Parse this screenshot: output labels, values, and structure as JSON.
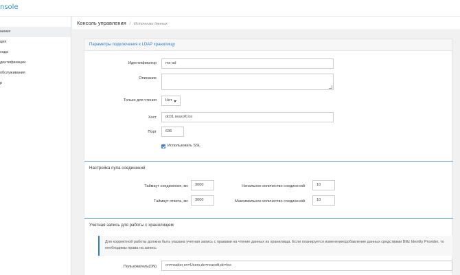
{
  "app": {
    "brand": "nsole"
  },
  "sidebar": {
    "items": [
      {
        "label": "нения",
        "active": true
      },
      {
        "label": "ция",
        "active": false
      },
      {
        "label": "хода",
        "active": false
      },
      {
        "label": "дентификации",
        "active": false
      },
      {
        "label": "обслуживания",
        "active": false
      },
      {
        "label": "р",
        "active": false
      }
    ]
  },
  "header": {
    "title": "Консоль управления",
    "separator": "/",
    "breadcrumb": "Источники данных"
  },
  "card": {
    "title": "Параметры подключения к LDAP хранилищу"
  },
  "form": {
    "identifier": {
      "label": "Идентификатор",
      "value": "ms-ad"
    },
    "description": {
      "label": "Описание",
      "value": ""
    },
    "readonly": {
      "label": "Только для чтения",
      "value": "Нет"
    },
    "host": {
      "label": "Хост",
      "value": "dc01.reaxoft.loc"
    },
    "port": {
      "label": "Порт",
      "value": "636"
    },
    "ssl": {
      "label": "Использовать SSL",
      "checked": true
    }
  },
  "pool": {
    "title": "Настройка пула соединений",
    "connect_timeout": {
      "label": "Таймаут соединения, мс",
      "value": "3000"
    },
    "response_timeout": {
      "label": "Таймаут ответа, мс",
      "value": "3000"
    },
    "initial_count": {
      "label": "Начальное количество соединений",
      "value": "10"
    },
    "max_count": {
      "label": "Максимальное количество соединений",
      "value": "10"
    }
  },
  "account": {
    "title": "Учетная запись для работы с хранилищем",
    "note": "Для корректной работы должна быть указана учетная запись с правами на чтение данных из хранилища. Если планируется изменение/добавление данных средствами Blitz Identity Provider, то необходимы права на запись",
    "user": {
      "label": "Пользователь(DN)",
      "value": "cn=reader,cn=Users,dc=reaxoft,dc=loc"
    }
  },
  "colors": {
    "accent": "#2a80c8",
    "checkbox": "#3b7dd8",
    "section_line": "#5aa3dd"
  }
}
